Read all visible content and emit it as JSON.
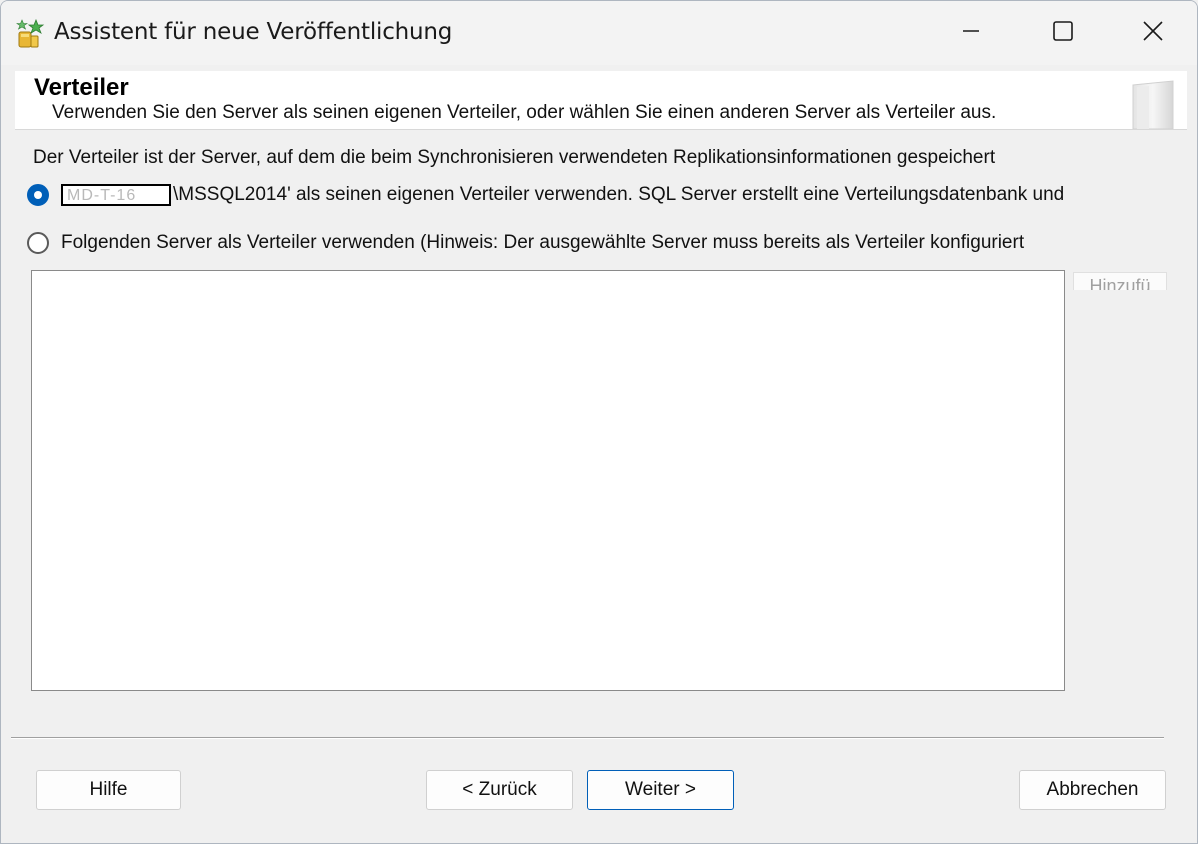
{
  "window": {
    "title": "Assistent für neue Veröffentlichung",
    "controls": [
      "minimize-icon",
      "maximize-icon",
      "close-icon"
    ]
  },
  "header": {
    "title": "Verteiler",
    "subtitle": "Verwenden Sie den Server als seinen eigenen Verteiler, oder wählen Sie einen anderen Server als Verteiler aus."
  },
  "main": {
    "info_text": "Der Verteiler ist der Server, auf dem die beim Synchronisieren verwendeten Replikationsinformationen gespeichert",
    "option_own": {
      "redacted_text": "MD-T-16",
      "label_suffix": "\\MSSQL2014' als seinen eigenen Verteiler verwenden. SQL Server erstellt eine Verteilungsdatenbank und",
      "selected": true
    },
    "option_other": {
      "label": "Folgenden Server als Verteiler verwenden (Hinweis: Der ausgewählte Server muss bereits als Verteiler konfiguriert",
      "selected": false
    },
    "add_button_label": "Hinzufü"
  },
  "footer": {
    "help_label": "Hilfe",
    "back_label": "< Zurück",
    "next_label": "Weiter >",
    "cancel_label": "Abbrechen"
  },
  "colors": {
    "accent": "#005fb8",
    "window_bg": "#f0f0f0",
    "header_bg": "#ffffff"
  }
}
